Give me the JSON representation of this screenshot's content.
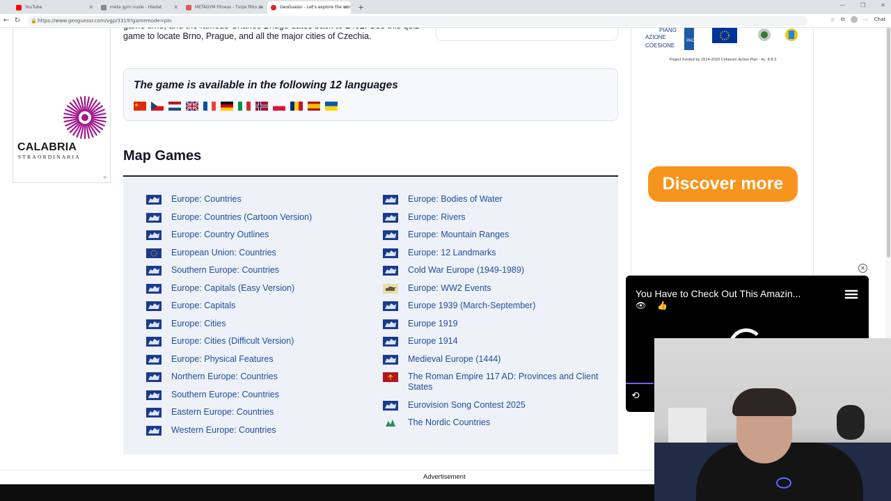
{
  "browser": {
    "tabs": [
      {
        "title": "YouTube",
        "fav_color": "#ff0000",
        "active": false
      },
      {
        "title": "meta gym nusle - Hledat",
        "fav_color": "#888888",
        "active": false
      },
      {
        "title": "METAGYM Fitness - Tvoje fitko za",
        "fav_color": "#e05a5a",
        "active": false
      },
      {
        "title": "GeoGuessr - Let's explore the wor",
        "fav_color": "#d6262b",
        "active": true
      }
    ],
    "url": "https://www.geoguessr.com/vgp/3319?gamemode=pin",
    "chat_label": "Chat"
  },
  "intro": {
    "text": "game time, and the famous Charles Bridge dates back to 1402. Use this quiz game to locate Brno, Prague, and all the major cities of Czechia."
  },
  "left_ad": {
    "brand": "CALABRIA",
    "tagline": "STRAORDINARIA"
  },
  "languages": {
    "title": "The game is available in the following 12 languages",
    "flags": [
      "china-flag",
      "czech-flag",
      "netherlands-flag",
      "uk-flag",
      "france-flag",
      "germany-flag",
      "italy-flag",
      "norway-flag",
      "poland-flag",
      "romania-flag",
      "spain-flag",
      "ukraine-flag"
    ]
  },
  "map_games": {
    "title": "Map Games",
    "left": [
      {
        "label": "Europe: Countries",
        "icon": "europe-map-icon"
      },
      {
        "label": "Europe: Countries (Cartoon Version)",
        "icon": "europe-map-icon"
      },
      {
        "label": "Europe: Country Outlines",
        "icon": "europe-map-icon"
      },
      {
        "label": "European Union: Countries",
        "icon": "eu-flag-icon"
      },
      {
        "label": "Southern Europe: Countries",
        "icon": "europe-map-icon"
      },
      {
        "label": "Europe: Capitals (Easy Version)",
        "icon": "europe-map-icon"
      },
      {
        "label": "Europe: Capitals",
        "icon": "europe-map-icon"
      },
      {
        "label": "Europe: Cities",
        "icon": "europe-map-icon"
      },
      {
        "label": "Europe: Cities (Difficult Version)",
        "icon": "europe-map-icon"
      },
      {
        "label": "Europe: Physical Features",
        "icon": "europe-map-icon"
      },
      {
        "label": "Northern Europe: Countries",
        "icon": "europe-map-icon"
      },
      {
        "label": "Southern Europe: Countries",
        "icon": "europe-map-icon"
      },
      {
        "label": "Eastern Europe: Countries",
        "icon": "europe-map-icon"
      },
      {
        "label": "Western Europe: Countries",
        "icon": "europe-map-icon"
      }
    ],
    "right": [
      {
        "label": "Europe: Bodies of Water",
        "icon": "europe-map-icon"
      },
      {
        "label": "Europe: Rivers",
        "icon": "europe-map-icon"
      },
      {
        "label": "Europe: Mountain Ranges",
        "icon": "europe-map-icon"
      },
      {
        "label": "Europe: 12 Landmarks",
        "icon": "europe-map-icon"
      },
      {
        "label": "Cold War Europe (1949-1989)",
        "icon": "europe-map-icon"
      },
      {
        "label": "Europe: WW2 Events",
        "icon": "ww2-tank-icon"
      },
      {
        "label": "Europe 1939 (March-September)",
        "icon": "europe-map-icon"
      },
      {
        "label": "Europe 1919",
        "icon": "europe-map-icon"
      },
      {
        "label": "Europe 1914",
        "icon": "europe-map-icon"
      },
      {
        "label": "Medieval Europe (1444)",
        "icon": "europe-map-icon"
      },
      {
        "label": "The Roman Empire 117 AD: Provinces and Client States",
        "icon": "roman-eagle-icon"
      },
      {
        "label": "Eurovision Song Contest 2025",
        "icon": "europe-map-icon"
      },
      {
        "label": "The Nordic Countries",
        "icon": "nordic-map-icon"
      }
    ]
  },
  "right_ad": {
    "piano": "PIANO",
    "azione": "AZIONE",
    "coesione": "COESIONE",
    "pac": "PAC",
    "funded": "Project funded by 2014-2020 Cohesion Action Plan - Ac. 6.8.3",
    "cta": "Discover more",
    "cta_color": "#f7941d"
  },
  "video_ad": {
    "title": "You Have to Check Out This Amazin..."
  },
  "advertisement_label": "Advertisement",
  "colors": {
    "link": "#1f4e9a",
    "games_bg": "#eef1f8"
  }
}
